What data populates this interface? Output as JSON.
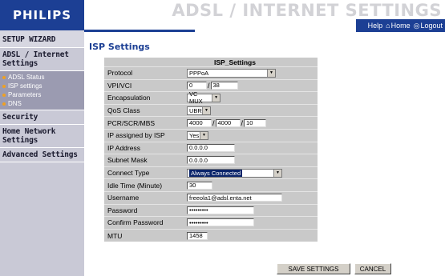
{
  "brand": {
    "logo_text": "PHILIPS"
  },
  "header": {
    "title": "ADSL / INTERNET SETTINGS"
  },
  "toplinks": {
    "help": "Help",
    "home": "Home",
    "logout": "Logout"
  },
  "sidebar": {
    "setup_wizard": "SETUP WIZARD",
    "adsl_internet": "ADSL / Internet Settings",
    "sub_items": [
      "ADSL Status",
      "ISP settings",
      "Parameters",
      "DNS"
    ],
    "security": "Security",
    "home_network": "Home Network Settings",
    "advanced": "Advanced Settings"
  },
  "main": {
    "title": "ISP Settings",
    "table_header": "ISP_Settings",
    "protocol": {
      "label": "Protocol",
      "value": "PPPoA"
    },
    "vpi_vci": {
      "label": "VPI/VCI",
      "vpi": "0",
      "vci": "38"
    },
    "encapsulation": {
      "label": "Encapsulation",
      "value": "VC MUX"
    },
    "qos": {
      "label": "QoS Class",
      "value": "UBR"
    },
    "pcr": {
      "label": "PCR/SCR/MBS",
      "pcr": "4000",
      "scr": "4000",
      "mbs": "10"
    },
    "ip_assigned": {
      "label": "IP assigned by ISP",
      "value": "Yes"
    },
    "ip_address": {
      "label": "IP Address",
      "value": "0.0.0.0"
    },
    "subnet": {
      "label": "Subnet Mask",
      "value": "0.0.0.0"
    },
    "connect_type": {
      "label": "Connect Type",
      "value": "Always Connected"
    },
    "idle_time": {
      "label": "Idle Time (Minute)",
      "value": "30"
    },
    "username": {
      "label": "Username",
      "value": "freeola1@adsl.enta.net"
    },
    "password": {
      "label": "Password",
      "value": "•••••••••"
    },
    "confirm_password": {
      "label": "Confirm Password",
      "value": "•••••••••"
    },
    "mtu": {
      "label": "MTU",
      "value": "1458"
    }
  },
  "buttons": {
    "save": "SAVE SETTINGS",
    "cancel": "CANCEL"
  },
  "colors": {
    "brand_blue": "#1c3f94",
    "sidebar_bg": "#c9c9d6",
    "sub_bg": "#9b9bb1",
    "form_bg": "#c9c9c9"
  }
}
